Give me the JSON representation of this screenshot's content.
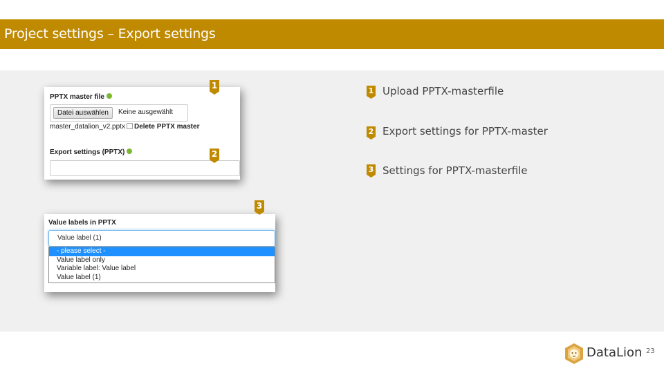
{
  "slide": {
    "title": "Project settings – Export settings",
    "page_number": "23",
    "brand": "DataLion",
    "accent_color": "#bf8a00"
  },
  "shot1": {
    "master_label": "PPTX master file",
    "file_button": "Datei auswählen",
    "file_status": "Keine ausgewählt",
    "current_file": "master_datalion_v2.pptx",
    "delete_label": "Delete PPTX master",
    "export_label": "Export settings (PPTX)"
  },
  "shot2": {
    "label": "Value labels in PPTX",
    "selected_value": "Value label (1)",
    "options": [
      "- please select -",
      "Value label only",
      "Variable label: Value label",
      "Value label (1)"
    ]
  },
  "badges": [
    "1",
    "2",
    "3"
  ],
  "legend": [
    {
      "num": "1",
      "text": "Upload PPTX-masterfile"
    },
    {
      "num": "2",
      "text": "Export settings for PPTX-master"
    },
    {
      "num": "3",
      "text": "Settings for PPTX-masterfile"
    }
  ],
  "icons": {
    "help": "help-icon",
    "logo": "lion-logo-icon",
    "badge": "number-badge"
  }
}
